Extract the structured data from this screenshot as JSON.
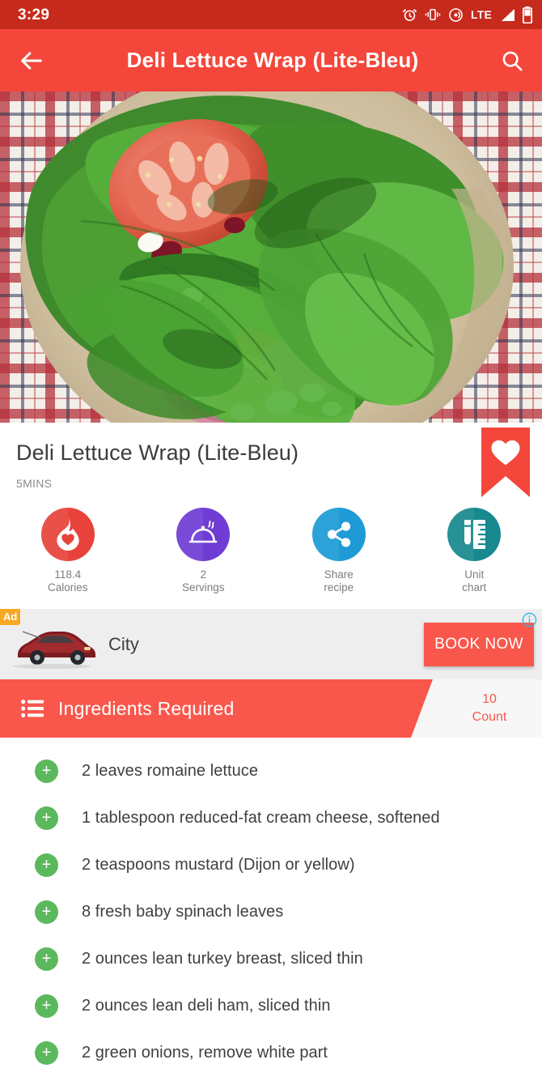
{
  "status_bar": {
    "time": "3:29",
    "network_label": "LTE",
    "icons": [
      "alarm-icon",
      "vibrate-icon",
      "hotspot-icon",
      "lte-label",
      "signal-icon",
      "battery-icon"
    ],
    "background_color": "#C62A1C"
  },
  "app_bar": {
    "title": "Deli Lettuce Wrap (Lite-Bleu)",
    "back_icon": "back-arrow-icon",
    "search_icon": "search-icon",
    "background_color": "#F4463A"
  },
  "hero": {
    "alt": "Deli lettuce wrap with tomato, spinach, ham and cheese on a beige plate over a red checkered tablecloth"
  },
  "recipe": {
    "title": "Deli Lettuce Wrap (Lite-Bleu)",
    "time": "5MINS",
    "bookmark_icon": "heart-bookmark-icon"
  },
  "stats": [
    {
      "value": "118.4",
      "label": "Calories",
      "icon": "flame-heart-icon",
      "color": "#E8433B"
    },
    {
      "value": "2",
      "label": "Servings",
      "icon": "cloche-icon",
      "color": "#6F3CD4"
    },
    {
      "value": "Share",
      "label": "recipe",
      "icon": "share-icon",
      "color": "#1E9BD7"
    },
    {
      "value": "Unit",
      "label": "chart",
      "icon": "ruler-pencil-icon",
      "color": "#17898F"
    }
  ],
  "ad": {
    "badge": "Ad",
    "info_icon": "info-icon",
    "product_name": "City",
    "cta_label": "BOOK NOW",
    "image_icon": "car-icon",
    "cta_color": "#F9574C",
    "badge_color": "#F9A825"
  },
  "section": {
    "title": "Ingredients Required",
    "icon": "bullet-list-icon",
    "count_value": "10",
    "count_label": "Count",
    "accent_color": "#F9574C"
  },
  "ingredients": [
    {
      "text": "2 leaves romaine lettuce",
      "add_icon": "plus-icon"
    },
    {
      "text": "1 tablespoon reduced-fat cream cheese, softened",
      "add_icon": "plus-icon"
    },
    {
      "text": "2 teaspoons mustard (Dijon or yellow)",
      "add_icon": "plus-icon"
    },
    {
      "text": "8 fresh baby spinach leaves",
      "add_icon": "plus-icon"
    },
    {
      "text": "2 ounces lean turkey breast, sliced thin",
      "add_icon": "plus-icon"
    },
    {
      "text": "2 ounces lean deli ham, sliced thin",
      "add_icon": "plus-icon"
    },
    {
      "text": "2 green onions, remove white part",
      "add_icon": "plus-icon"
    }
  ]
}
